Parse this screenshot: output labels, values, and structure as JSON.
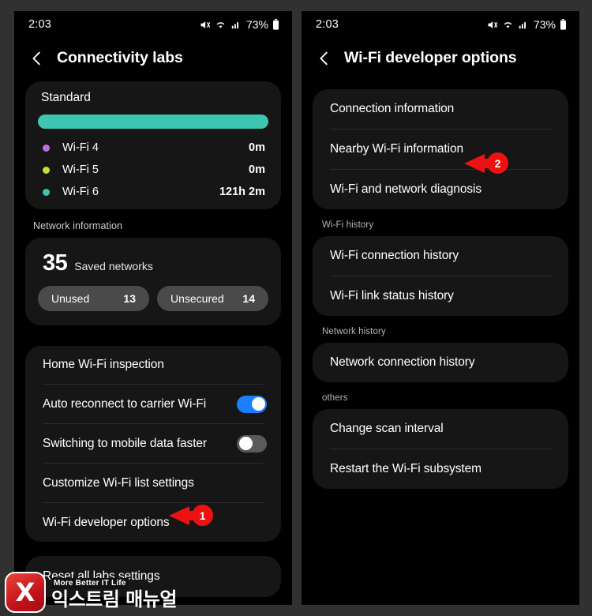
{
  "statusbar": {
    "time": "2:03",
    "battery_percent": "73%",
    "icons": [
      "mute-icon",
      "wifi-icon",
      "signal-icon",
      "battery-icon"
    ]
  },
  "left_panel": {
    "title": "Connectivity labs",
    "back_icon": "back-chevron-icon",
    "standard_card": {
      "title": "Standard",
      "bar_color": "#3dc5b0",
      "bar_percent": 100,
      "entries": [
        {
          "label": "Wi-Fi 4",
          "value": "0m",
          "color": "#c06fe0"
        },
        {
          "label": "Wi-Fi 5",
          "value": "0m",
          "color": "#c2e032"
        },
        {
          "label": "Wi-Fi 6",
          "value": "121h 2m",
          "color": "#3dc5b0"
        }
      ]
    },
    "network_information": {
      "section_label": "Network information",
      "count": "35",
      "count_label": "Saved networks",
      "chips": [
        {
          "label": "Unused",
          "value": "13"
        },
        {
          "label": "Unsecured",
          "value": "14"
        }
      ]
    },
    "settings": [
      {
        "label": "Home Wi-Fi inspection",
        "type": "link"
      },
      {
        "label": "Auto reconnect to carrier Wi-Fi",
        "type": "toggle",
        "state": "on"
      },
      {
        "label": "Switching to mobile data faster",
        "type": "toggle",
        "state": "off"
      },
      {
        "label": "Customize Wi-Fi list settings",
        "type": "link"
      },
      {
        "label": "Wi-Fi developer options",
        "type": "link"
      }
    ],
    "reset": {
      "label": "Reset all labs settings"
    }
  },
  "right_panel": {
    "title": "Wi-Fi developer options",
    "back_icon": "back-chevron-icon",
    "groups": [
      {
        "section_label": "",
        "items": [
          {
            "label": "Connection information"
          },
          {
            "label": "Nearby Wi-Fi information"
          },
          {
            "label": "Wi-Fi and network diagnosis"
          }
        ]
      },
      {
        "section_label": "Wi-Fi history",
        "items": [
          {
            "label": "Wi-Fi connection history"
          },
          {
            "label": "Wi-Fi link status history"
          }
        ]
      },
      {
        "section_label": "Network history",
        "items": [
          {
            "label": "Network connection history"
          }
        ]
      },
      {
        "section_label": "others",
        "items": [
          {
            "label": "Change scan interval"
          },
          {
            "label": "Restart the Wi-Fi subsystem"
          }
        ]
      }
    ]
  },
  "annotations": [
    {
      "number": "1",
      "target": "Wi-Fi developer options",
      "color": "#ee1111"
    },
    {
      "number": "2",
      "target": "Nearby Wi-Fi information",
      "color": "#ee1111"
    }
  ],
  "watermark": {
    "logo_letter": "X",
    "tagline": "More Better IT Life",
    "brand": "익스트림 매뉴얼"
  }
}
